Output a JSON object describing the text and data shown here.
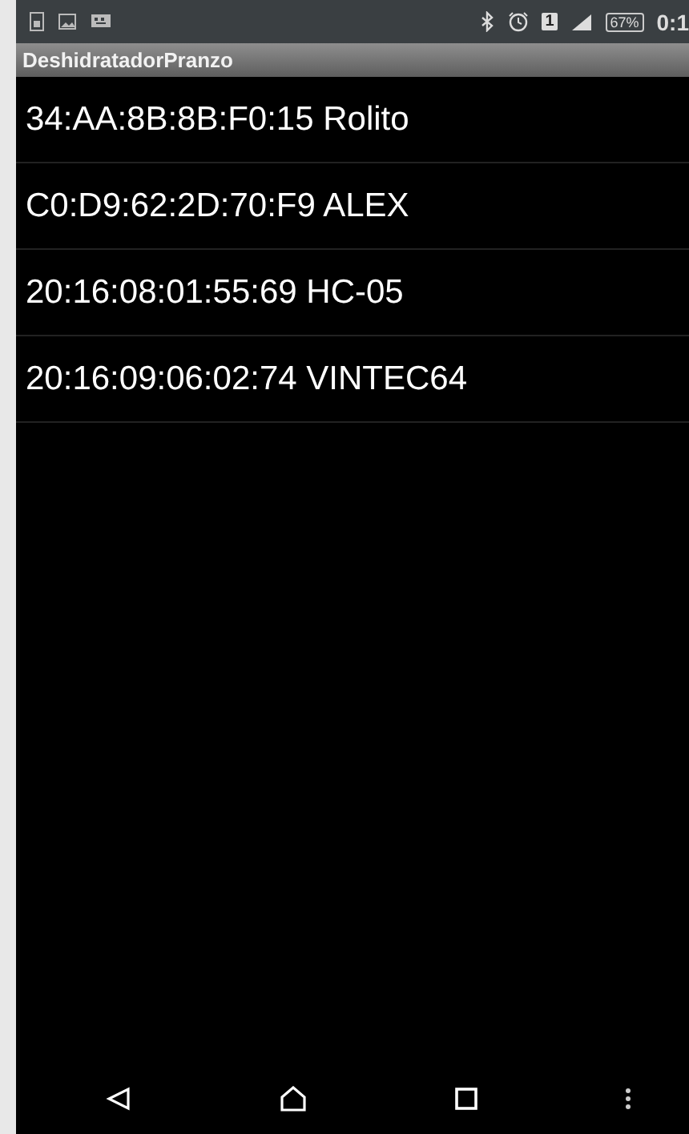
{
  "status_bar": {
    "sim": "1",
    "battery": "67%",
    "time": "0:1"
  },
  "app_bar": {
    "title": "DeshidratadorPranzo"
  },
  "devices": [
    {
      "label": "34:AA:8B:8B:F0:15 Rolito"
    },
    {
      "label": "C0:D9:62:2D:70:F9 ALEX"
    },
    {
      "label": "20:16:08:01:55:69 HC-05"
    },
    {
      "label": "20:16:09:06:02:74 VINTEC64"
    }
  ]
}
